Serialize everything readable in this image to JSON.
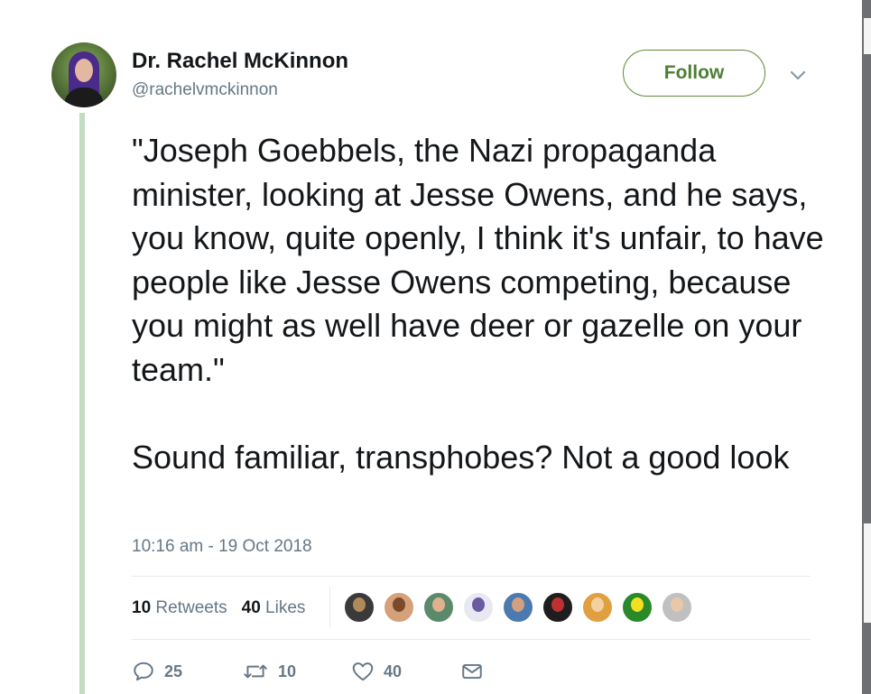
{
  "tweet": {
    "author": {
      "display_name": "Dr. Rachel McKinnon",
      "handle": "@rachelvmckinnon"
    },
    "follow_label": "Follow",
    "text": "\"Joseph Goebbels, the Nazi propaganda minister, looking at Jesse Owens, and he says, you know, quite openly, I think it's unfair, to have people like Jesse Owens competing, because you might as well have deer or gazelle on your team.\"\n\nSound familiar, transphobes? Not a good look",
    "timestamp": "10:16 am - 19 Oct 2018",
    "stats": {
      "retweets_count": "10",
      "retweets_label": "Retweets",
      "likes_count": "40",
      "likes_label": "Likes"
    },
    "liker_avatars": [
      {
        "bg": "#3a3a3a",
        "head": "#b08a5a"
      },
      {
        "bg": "#d6a07a",
        "head": "#7a4a2a"
      },
      {
        "bg": "#5a8a6a",
        "head": "#e0b090"
      },
      {
        "bg": "#e8e8f4",
        "head": "#6a5aa0"
      },
      {
        "bg": "#4a7ab0",
        "head": "#d0a080"
      },
      {
        "bg": "#1e1e1e",
        "head": "#c03030"
      },
      {
        "bg": "#e0a040",
        "head": "#f4d0a0"
      },
      {
        "bg": "#2a8a2a",
        "head": "#f0e020"
      },
      {
        "bg": "#c0c0c0",
        "head": "#e8c8a8"
      }
    ],
    "actions": {
      "reply_count": "25",
      "retweet_count": "10",
      "like_count": "40"
    }
  },
  "colors": {
    "follow_accent": "#4d7f33",
    "thread_line": "#c2dcc1",
    "secondary_text": "#657786"
  }
}
